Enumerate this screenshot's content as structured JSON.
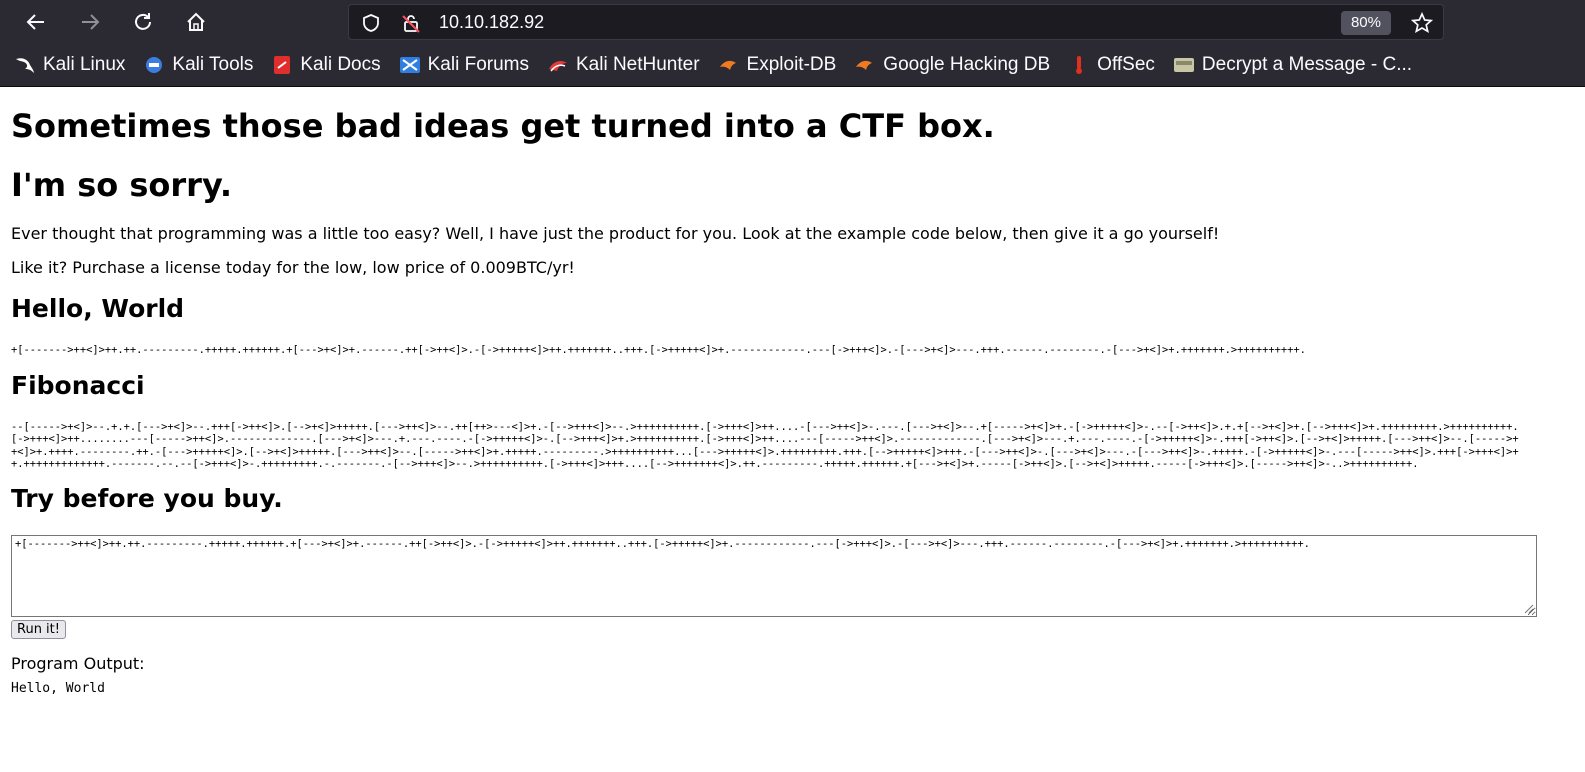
{
  "browser": {
    "url": "10.10.182.92",
    "zoom": "80%",
    "bookmarks": [
      {
        "label": "Kali Linux",
        "icon": "kali-dragon-icon"
      },
      {
        "label": "Kali Tools",
        "icon": "kali-tools-icon"
      },
      {
        "label": "Kali Docs",
        "icon": "kali-docs-icon"
      },
      {
        "label": "Kali Forums",
        "icon": "kali-forums-icon"
      },
      {
        "label": "Kali NetHunter",
        "icon": "nethunter-icon"
      },
      {
        "label": "Exploit-DB",
        "icon": "exploit-db-icon"
      },
      {
        "label": "Google Hacking DB",
        "icon": "ghdb-icon"
      },
      {
        "label": "OffSec",
        "icon": "offsec-icon"
      },
      {
        "label": "Decrypt a Message - C...",
        "icon": "decrypt-icon"
      }
    ]
  },
  "page": {
    "heading1": "Sometimes those bad ideas get turned into a CTF box.",
    "heading2": "I'm so sorry.",
    "intro": "Ever thought that programming was a little too easy? Well, I have just the product for you. Look at the example code below, then give it a go yourself!",
    "price": "Like it? Purchase a license today for the low, low price of 0.009BTC/yr!",
    "hello_title": "Hello, World",
    "hello_code": "+[------->++<]>++.++.---------.+++++.++++++.+[--->+<]>+.------.++[->++<]>.-[->+++++<]>++.+++++++..+++.[->+++++<]>+.------------.---[->+++<]>.-[--->+<]>---.+++.------.--------.-[--->+<]>+.+++++++.>++++++++++.",
    "fib_title": "Fibonacci",
    "fib_code": "--[----->+<]>--.+.+.[--->+<]>--.+++[->++<]>.[-->+<]>+++++.[--->++<]>--.++[++>---<]>+.-[-->+++<]>--.>++++++++++.[->+++<]>++....-[--->++<]>-.---.[--->+<]>--.+[----->+<]>+.-[->+++++<]>-.--[->++<]>.+.+[-->+<]>+.[-->+++<]>+.+++++++++.>++++++++++.[->+++<]>++........---[----->++<]>.-------------.[--->+<]>---.+.---.----.-[->+++++<]>-.[-->+++<]>+.>++++++++++.[->+++<]>++....---[----->++<]>.-------------.[--->+<]>---.+.---.----.-[->+++++<]>-.+++[->++<]>.[-->+<]>+++++.[--->++<]>--.[----->++<]>+.++++.--------.++.-[--->+++++<]>.[-->+<]>+++++.[--->++<]>--.[----->++<]>+.+++++.---------.>++++++++++...[--->+++++<]>.+++++++++.+++.[-->+++++<]>+++.-[--->++<]>-.[--->+<]>---.-[--->++<]>-.+++++.-[->+++++<]>-.---[----->++<]>.+++[->+++<]>++.+++++++++++++.-------.--.--[->+++<]>-.+++++++++.-.-------.-[-->+++<]>--.>++++++++++.[->+++<]>+++....[-->+++++++<]>.++.---------.+++++.++++++.+[--->+<]>+.-----[->++<]>.[-->+<]>+++++.-----[->+++<]>.[----->++<]>-..>++++++++++.",
    "try_title": "Try before you buy.",
    "editor_value": "+[------->++<]>++.++.---------.+++++.++++++.+[--->+<]>+.------.++[->++<]>.-[->+++++<]>++.+++++++..+++.[->+++++<]>+.------------.---[->+++<]>.-[--->+<]>---.+++.------.--------.-[--->+<]>+.+++++++.>++++++++++.",
    "run_label": "Run it!",
    "output_label": "Program Output:",
    "output_value": "Hello, World"
  }
}
